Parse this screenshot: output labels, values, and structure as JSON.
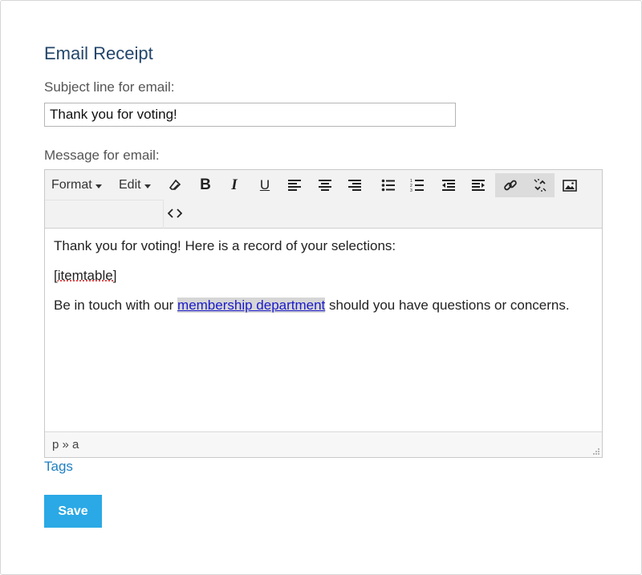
{
  "section_title": "Email Receipt",
  "subject": {
    "label": "Subject line for email:",
    "value": "Thank you for voting!"
  },
  "message": {
    "label": "Message for email:"
  },
  "toolbar": {
    "format_label": "Format",
    "edit_label": "Edit",
    "tools": [
      "eraser-icon",
      "bold-icon",
      "italic-icon",
      "underline-icon",
      "align-left-icon",
      "align-center-icon",
      "align-right-icon",
      "bullet-list-icon",
      "numbered-list-icon",
      "outdent-icon",
      "indent-icon",
      "link-icon",
      "unlink-icon",
      "image-icon",
      "source-code-icon"
    ],
    "active_tools": [
      "link-icon",
      "unlink-icon"
    ]
  },
  "editor_content": {
    "line1": "Thank you for voting! Here is a record of your selections:",
    "line2": "[itemtable]",
    "line3_before": "Be in touch with our ",
    "line3_link": "membership department",
    "line3_after": " should you have questions or concerns."
  },
  "statusbar": {
    "path": "p » a"
  },
  "tags_link": "Tags",
  "save_button": "Save",
  "colors": {
    "title": "#23466b",
    "link": "#1f7fc1",
    "save_bg": "#2aa9e6",
    "editor_link": "#1a1acc"
  }
}
